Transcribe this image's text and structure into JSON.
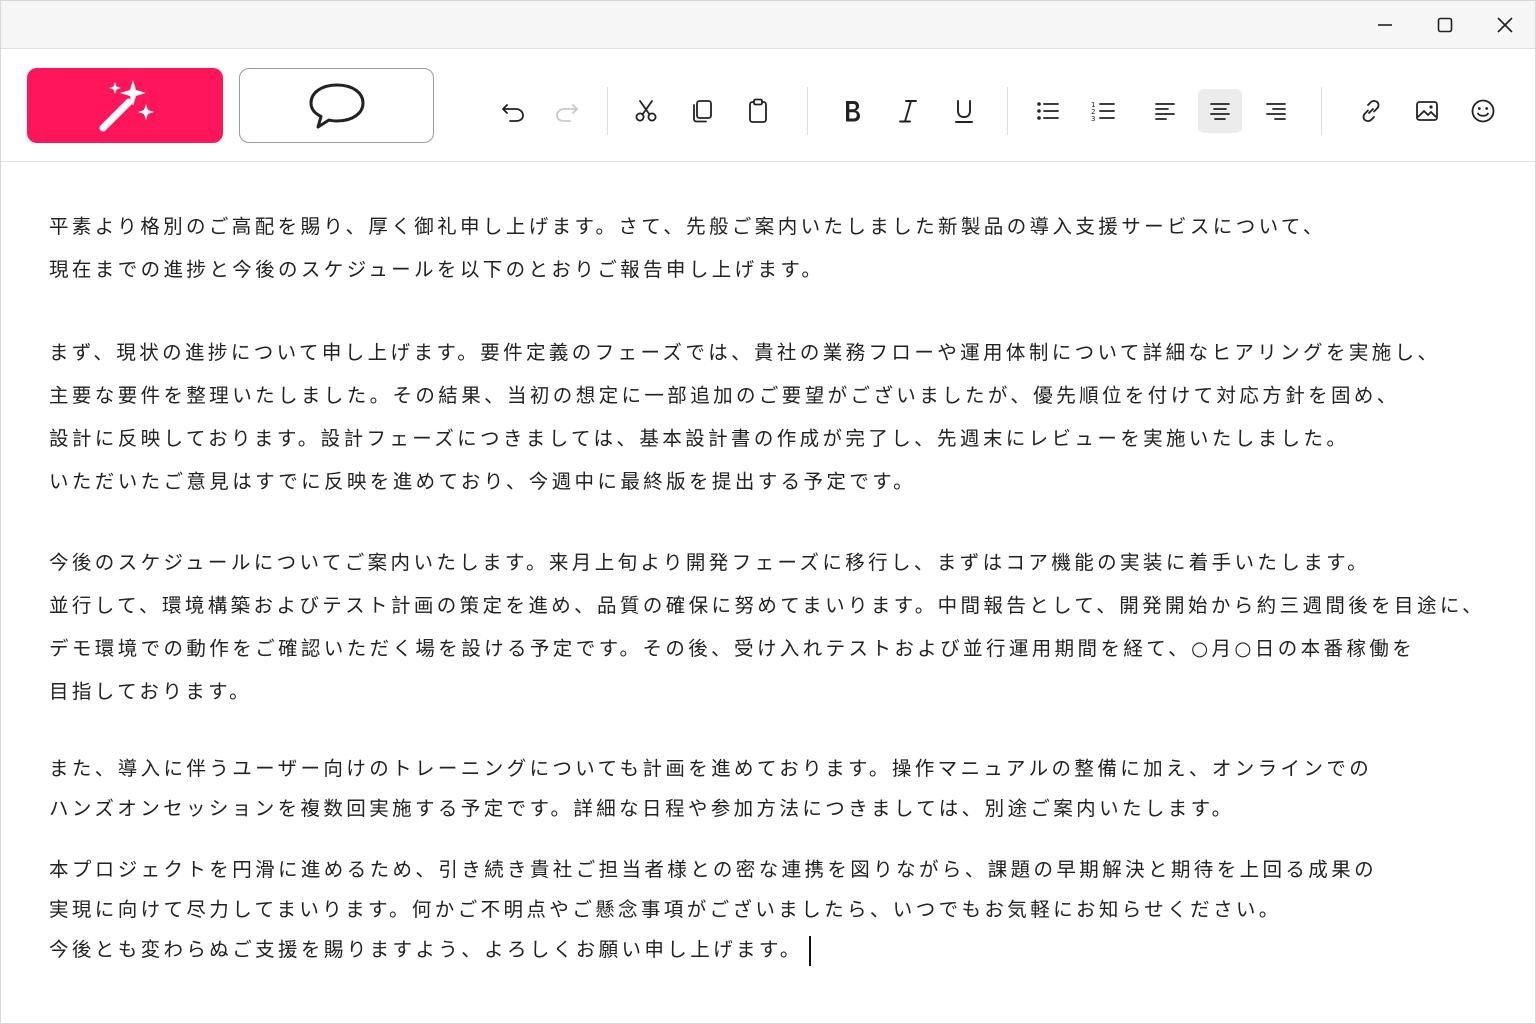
{
  "window_controls": {
    "minimize_icon": "minimize-icon",
    "maximize_icon": "maximize-icon",
    "close_icon": "close-icon"
  },
  "toolbar": {
    "ai_button": {
      "icon": "magic-wand-icon",
      "color": "#ff1559"
    },
    "comment_button": {
      "icon": "speech-bubble-icon"
    },
    "tools": [
      {
        "name": "undo",
        "icon": "undo-icon"
      },
      {
        "name": "redo",
        "icon": "redo-icon",
        "disabled": true
      },
      {
        "name": "cut",
        "icon": "scissors-icon"
      },
      {
        "name": "copy",
        "icon": "copy-icon"
      },
      {
        "name": "paste",
        "icon": "clipboard-icon"
      },
      {
        "name": "bold",
        "icon": "bold-icon"
      },
      {
        "name": "italic",
        "icon": "italic-icon"
      },
      {
        "name": "underline",
        "icon": "underline-icon"
      },
      {
        "name": "bullet-list",
        "icon": "bullet-list-icon"
      },
      {
        "name": "numbered-list",
        "icon": "numbered-list-icon"
      },
      {
        "name": "align-left",
        "icon": "align-left-icon"
      },
      {
        "name": "align-center",
        "icon": "align-center-icon",
        "active": true
      },
      {
        "name": "align-right",
        "icon": "align-right-icon"
      },
      {
        "name": "link",
        "icon": "link-icon"
      },
      {
        "name": "image",
        "icon": "image-icon"
      },
      {
        "name": "emoji",
        "icon": "emoji-icon"
      }
    ]
  },
  "document": {
    "paragraphs": [
      {
        "lines": [
          "平素より格別のご高配を賜り、厚く御礼申し上げます。さて、先般ご案内いたしました新製品の導入支援サービスについて、",
          "現在までの進捗と今後のスケジュールを以下のとおりご報告申し上げます。"
        ]
      },
      {
        "lines": [
          "まず、現状の進捗について申し上げます。要件定義のフェーズでは、貴社の業務フローや運用体制について詳細なヒアリングを実施し、",
          "主要な要件を整理いたしました。その結果、当初の想定に一部追加のご要望がございましたが、優先順位を付けて対応方針を固め、",
          "設計に反映しております。設計フェーズにつきましては、基本設計書の作成が完了し、先週末にレビューを実施いたしました。",
          "いただいたご意見はすでに反映を進めており、今週中に最終版を提出する予定です。"
        ]
      },
      {
        "lines": [
          "今後のスケジュールについてご案内いたします。来月上旬より開発フェーズに移行し、まずはコア機能の実装に着手いたします。",
          "並行して、環境構築およびテスト計画の策定を進め、品質の確保に努めてまいります。中間報告として、開発開始から約三週間後を目途に、",
          "デモ環境での動作をご確認いただく場を設ける予定です。その後、受け入れテストおよび並行運用期間を経て、○月○日の本番稼働を",
          "目指しております。"
        ]
      },
      {
        "lines": [
          "また、導入に伴うユーザー向けのトレーニングについても計画を進めております。操作マニュアルの整備に加え、オンラインでの",
          "ハンズオンセッションを複数回実施する予定です。詳細な日程や参加方法につきましては、別途ご案内いたします。"
        ]
      },
      {
        "lines": [
          "本プロジェクトを円滑に進めるため、引き続き貴社ご担当者様との密な連携を図りながら、課題の早期解決と期待を上回る成果の",
          "実現に向けて尽力してまいります。何かご不明点やご懸念事項がございましたら、いつでもお気軽にお知らせください。",
          "今後とも変わらぬご支援を賜りますよう、よろしくお願い申し上げます。"
        ]
      }
    ]
  }
}
